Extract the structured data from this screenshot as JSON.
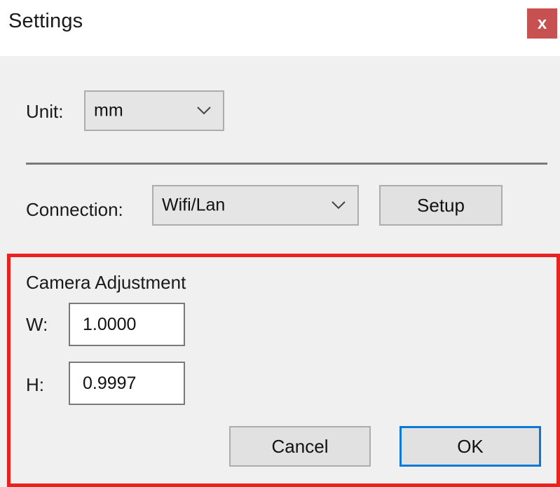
{
  "window": {
    "title": "Settings",
    "close_label": "x"
  },
  "unit": {
    "label": "Unit:",
    "selected": "mm"
  },
  "connection": {
    "label": "Connection:",
    "selected": "Wifi/Lan",
    "setup_label": "Setup"
  },
  "camera": {
    "group_label": "Camera Adjustment",
    "w_label": "W:",
    "w_value": "1.0000",
    "h_label": "H:",
    "h_value": "0.9997"
  },
  "actions": {
    "cancel_label": "Cancel",
    "ok_label": "OK"
  },
  "colors": {
    "close_button": "#c75050",
    "highlight": "#e8231f",
    "default_button_border": "#0a78d7"
  },
  "icons": {
    "combo_arrow": "chevron-down-icon"
  }
}
